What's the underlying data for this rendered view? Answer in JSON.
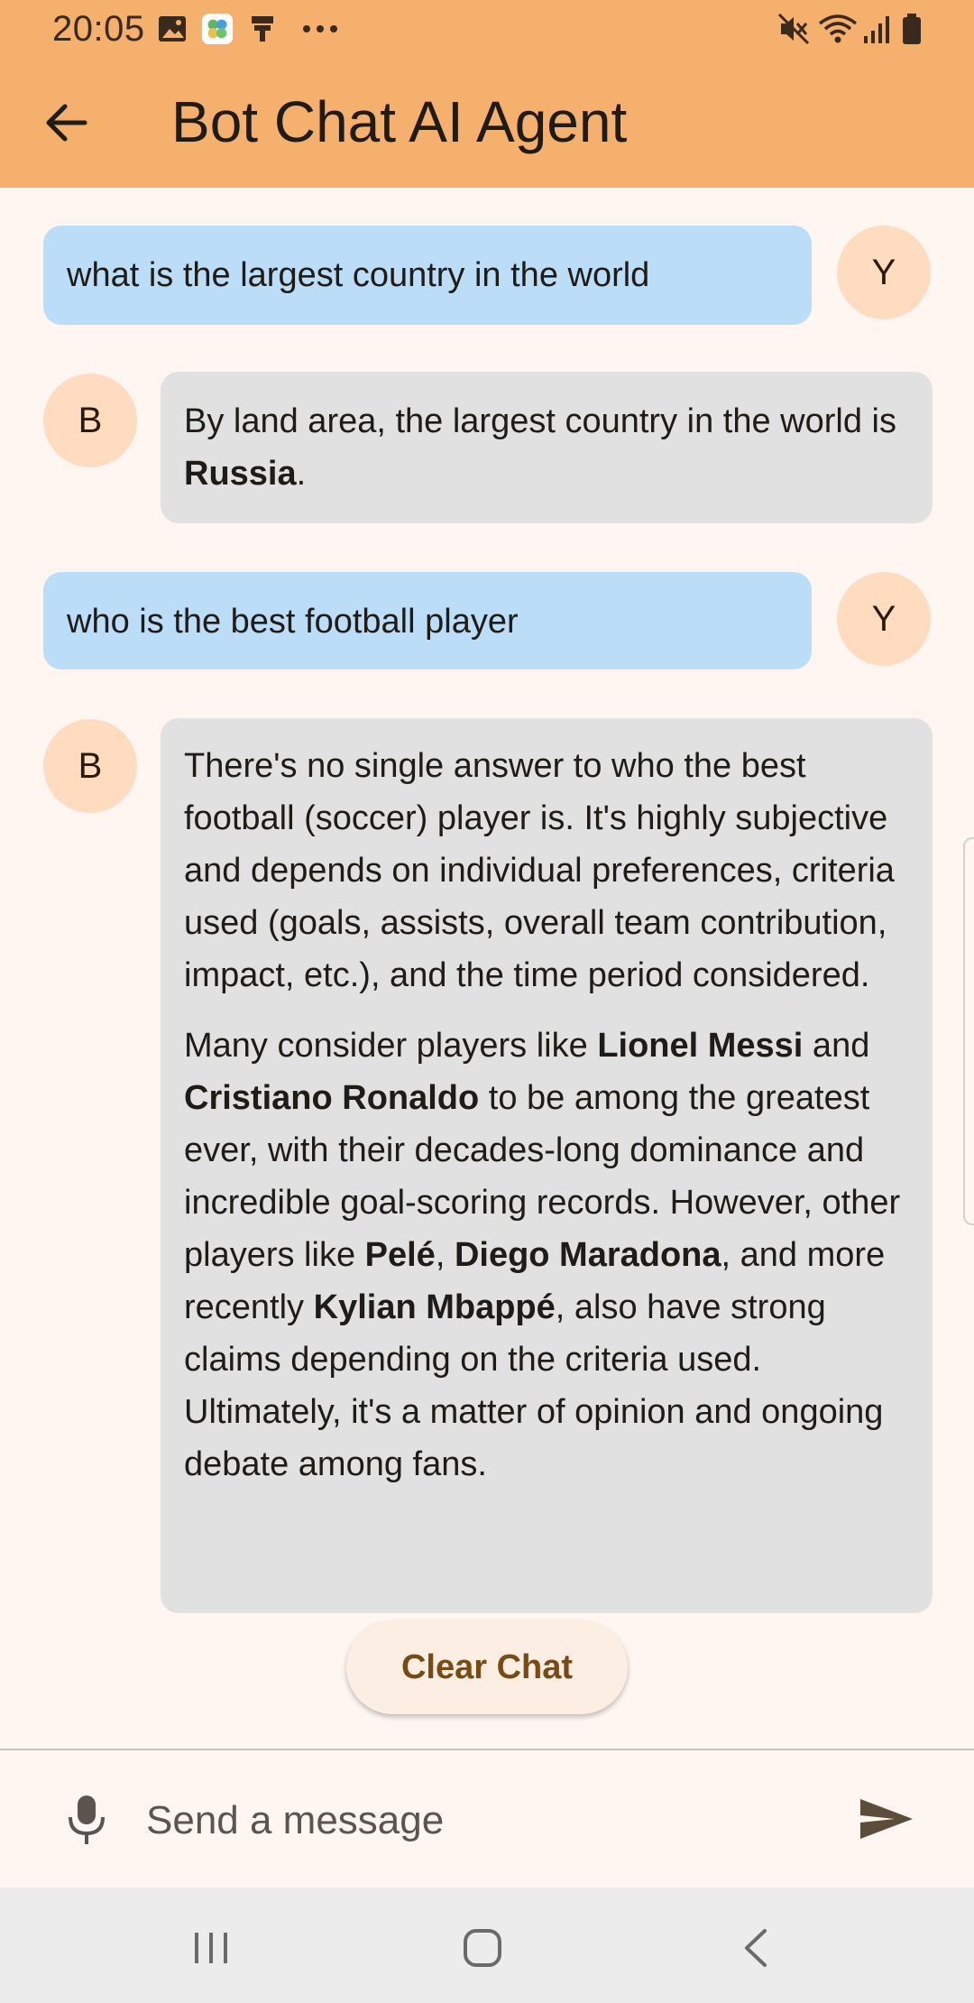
{
  "status_bar": {
    "time": "20:05",
    "left_icons": [
      "image-icon",
      "photos-icon",
      "notification-icon",
      "more-dots-icon"
    ],
    "right_icons": [
      "mute-icon",
      "wifi-icon",
      "signal-icon",
      "battery-icon"
    ]
  },
  "app_bar": {
    "title": "Bot Chat AI Agent",
    "back_icon": "arrow-left-icon"
  },
  "messages": [
    {
      "sender": "user",
      "avatar": "Y",
      "text": "what is the largest country in the world"
    },
    {
      "sender": "bot",
      "avatar": "B",
      "paragraphs": [
        [
          {
            "t": "By land area, the largest country in the world is "
          },
          {
            "t": "Russia",
            "b": true
          },
          {
            "t": "."
          }
        ]
      ]
    },
    {
      "sender": "user",
      "avatar": "Y",
      "text": "who is the best football player"
    },
    {
      "sender": "bot",
      "avatar": "B",
      "paragraphs": [
        [
          {
            "t": "There's no single answer to who the best football (soccer) player is.  It's highly subjective and depends on individual preferences, criteria used (goals, assists, overall team contribution, impact, etc.), and the time period considered."
          }
        ],
        [
          {
            "t": "Many consider players like "
          },
          {
            "t": "Lionel Messi",
            "b": true
          },
          {
            "t": " and "
          },
          {
            "t": "Cristiano Ronaldo",
            "b": true
          },
          {
            "t": " to be among the greatest ever, with their decades-long dominance and incredible goal-scoring records.  However, other players like "
          },
          {
            "t": "Pelé",
            "b": true
          },
          {
            "t": ", "
          },
          {
            "t": "Diego Maradona",
            "b": true
          },
          {
            "t": ", and more recently "
          },
          {
            "t": "Kylian Mbappé",
            "b": true
          },
          {
            "t": ",  also have strong claims depending on the criteria used.  Ultimately, it's a matter of opinion and ongoing debate among fans."
          }
        ]
      ]
    }
  ],
  "actions": {
    "clear_label": "Clear Chat"
  },
  "composer": {
    "placeholder": "Send a message",
    "mic_icon": "mic-icon",
    "send_icon": "send-icon"
  },
  "nav_bar": {
    "icons": [
      "recent-apps-icon",
      "home-icon",
      "back-icon"
    ]
  },
  "colors": {
    "app_bar": "#F5B06E",
    "background": "#FFF6F2",
    "user_bubble": "#BBDDF7",
    "bot_bubble": "#E2E1E1",
    "avatar": "#FFDCC0",
    "accent_text": "#7A4A14"
  }
}
